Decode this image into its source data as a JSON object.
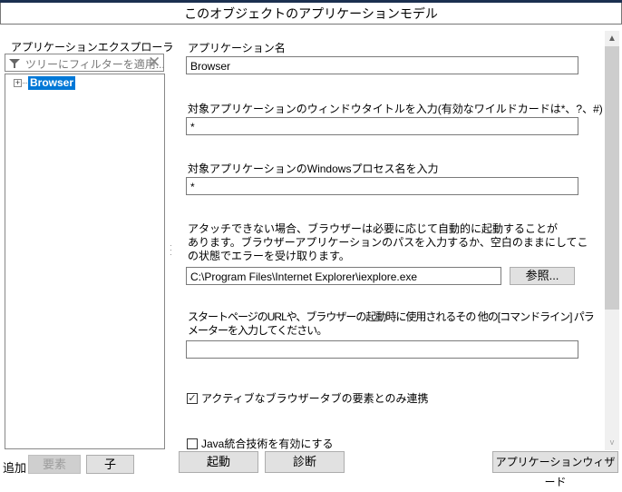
{
  "window": {
    "title": "このオブジェクトのアプリケーションモデル"
  },
  "explorer": {
    "label": "アプリケーションエクスプローラ",
    "filter_placeholder": "ツリーにフィルターを適用...",
    "tree": [
      {
        "label": "Browser",
        "expanded": false,
        "selected": true
      }
    ]
  },
  "form": {
    "app_name_label": "アプリケーション名",
    "app_name_value": "Browser",
    "window_title_label": "対象アプリケーションのウィンドウタイトルを入力(有効なワイルドカードは*、?、#)",
    "window_title_value": "*",
    "process_label": "対象アプリケーションのWindowsプロセス名を入力",
    "process_value": "*",
    "path_desc_lines": [
      "アタッチできない場合、ブラウザーは必要に応じて自動的に起動することが",
      "あります。ブラウザーアプリケーションのパスを入力するか、空白のままにしてこ",
      "の状態でエラーを受け取ります。"
    ],
    "path_value": "C:\\Program Files\\Internet Explorer\\iexplore.exe",
    "browse_label": "参照...",
    "start_desc_lines": [
      "スタートページのURLや、ブラウザーの起動時に使用されるその 他の[コマンドライン] パラ",
      "メーターを入力してください。"
    ],
    "start_value": "",
    "active_tab_label": "アクティブなブラウザータブの要素とのみ連携",
    "active_tab_checked": true,
    "java_label": "Java統合技術を有効にする",
    "java_checked": false
  },
  "footer": {
    "add_label": "追加",
    "element_label": "要素",
    "child_label": "子",
    "launch_label": "起動",
    "diagnose_label": "診断",
    "wizard_label": "アプリケーションウィザード"
  }
}
